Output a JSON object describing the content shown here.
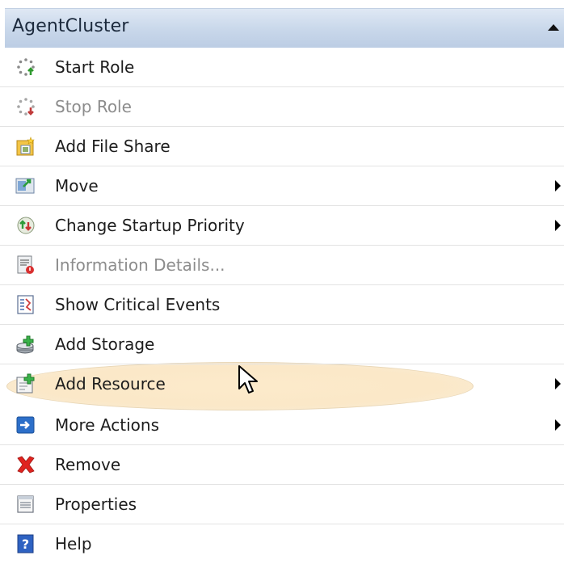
{
  "header": {
    "title": "AgentCluster"
  },
  "menu": {
    "items": [
      {
        "label": "Start Role",
        "icon": "start-role-icon",
        "enabled": true,
        "submenu": false
      },
      {
        "label": "Stop Role",
        "icon": "stop-role-icon",
        "enabled": false,
        "submenu": false
      },
      {
        "label": "Add File Share",
        "icon": "add-file-share-icon",
        "enabled": true,
        "submenu": false
      },
      {
        "label": "Move",
        "icon": "move-icon",
        "enabled": true,
        "submenu": true
      },
      {
        "label": "Change Startup Priority",
        "icon": "startup-priority-icon",
        "enabled": true,
        "submenu": true
      },
      {
        "label": "Information Details...",
        "icon": "information-details-icon",
        "enabled": false,
        "submenu": false
      },
      {
        "label": "Show Critical Events",
        "icon": "critical-events-icon",
        "enabled": true,
        "submenu": false
      },
      {
        "label": "Add Storage",
        "icon": "add-storage-icon",
        "enabled": true,
        "submenu": false
      },
      {
        "label": "Add Resource",
        "icon": "add-resource-icon",
        "enabled": true,
        "submenu": true,
        "highlighted": true
      },
      {
        "label": "More Actions",
        "icon": "more-actions-icon",
        "enabled": true,
        "submenu": true
      },
      {
        "label": "Remove",
        "icon": "remove-icon",
        "enabled": true,
        "submenu": false
      },
      {
        "label": "Properties",
        "icon": "properties-icon",
        "enabled": true,
        "submenu": false
      },
      {
        "label": "Help",
        "icon": "help-icon",
        "enabled": true,
        "submenu": false
      }
    ]
  },
  "colors": {
    "header_gradient_top": "#dfe8f4",
    "header_gradient_bottom": "#bccde4",
    "highlight": "#fce9c8",
    "disabled_text": "#8c8c8c",
    "text": "#1d1d1d"
  }
}
